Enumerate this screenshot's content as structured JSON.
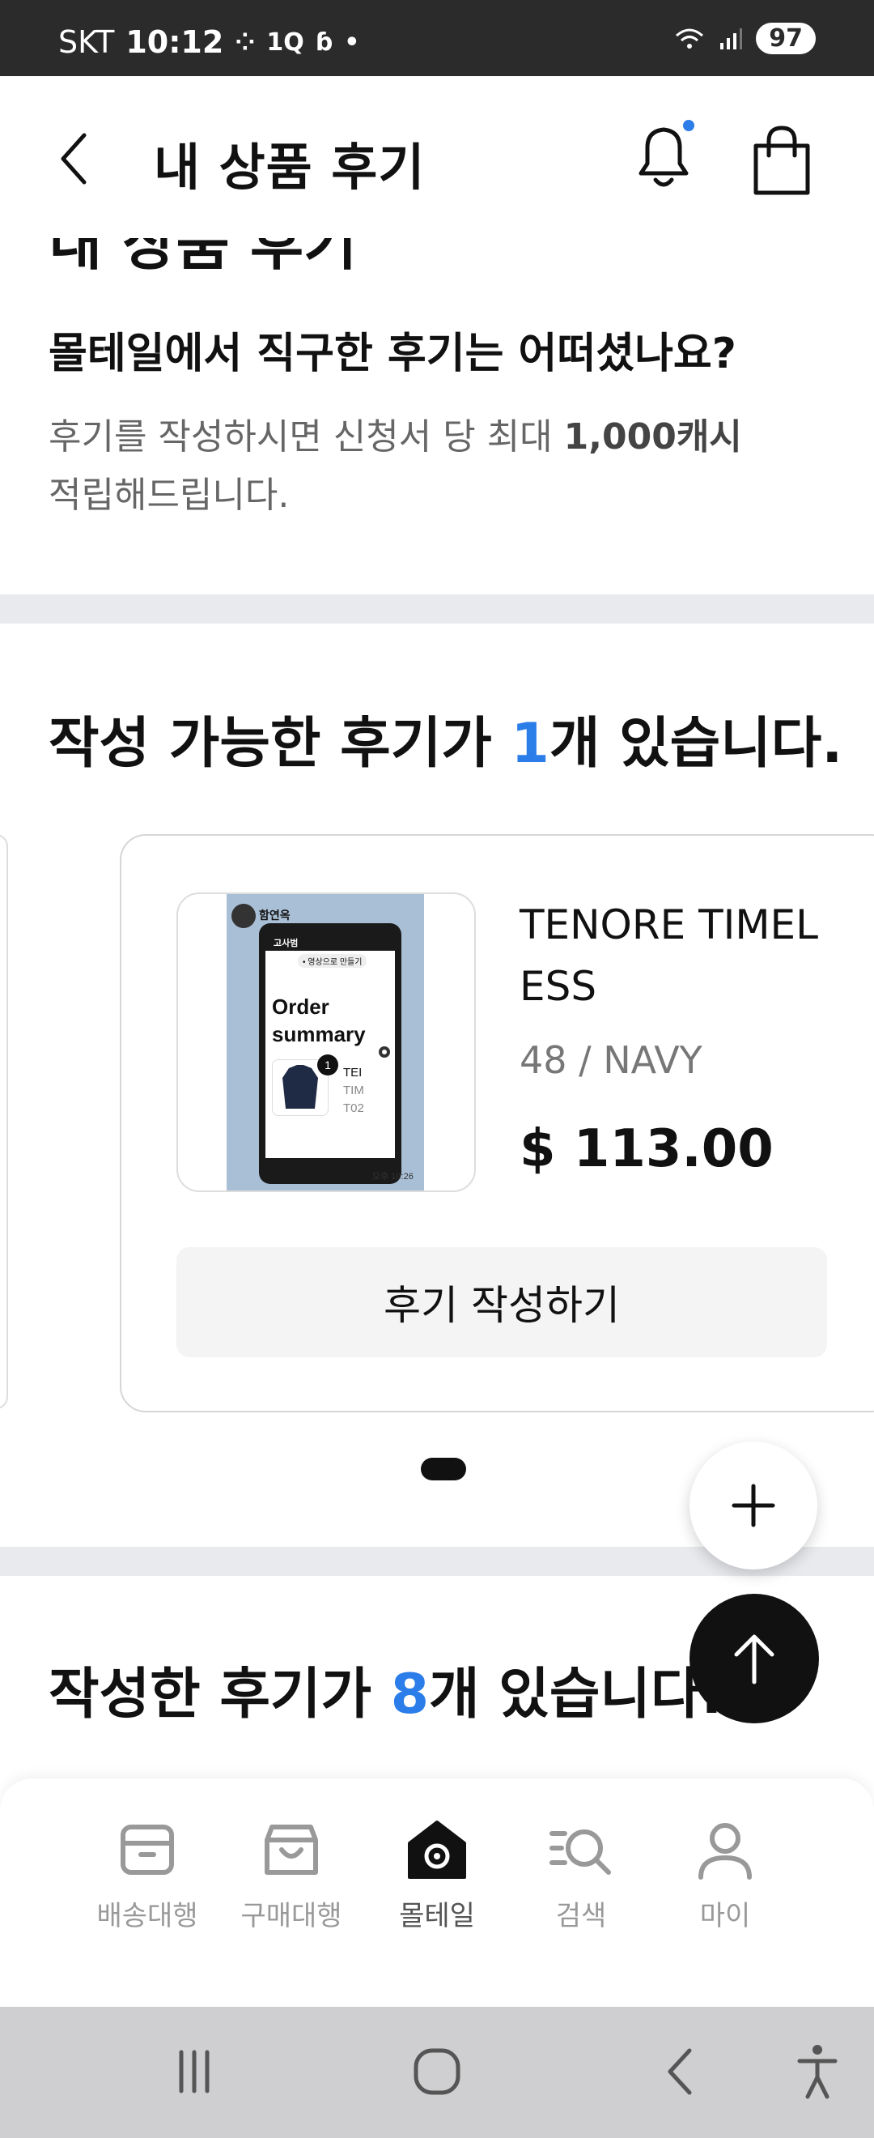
{
  "status_bar": {
    "carrier": "SKT",
    "time": "10:12",
    "battery": "97"
  },
  "header": {
    "title": "내 상품 후기",
    "back_icon": "chevron-left-icon",
    "bell_icon": "bell-icon",
    "cart_icon": "shopping-bag-icon",
    "notification_dot_color": "#2b7de9"
  },
  "intro": {
    "heading": "내 상품 후기",
    "subtitle": "몰테일에서 직구한 후기는 어떠셨나요?",
    "desc_prefix": "후기를 작성하시면 신청서 당 최대 ",
    "desc_bold": "1,000캐시",
    "desc_suffix": "적립해드립니다."
  },
  "writable_section": {
    "title_prefix": "작성 가능한 후기가 ",
    "count": "1",
    "title_suffix": "개 있습니다."
  },
  "review_card": {
    "product_name": "TENORE TIMELESS",
    "product_name_line1": "TENORE TIMEL",
    "product_name_line2": "ESS",
    "option": "48 / NAVY",
    "price": "$ 113.00",
    "write_button": "후기 작성하기",
    "thumbnail": {
      "sender": "함연옥",
      "chat_name": "고사범",
      "overlay_button": "• 영상으로 만들기",
      "order_line1": "Order",
      "order_line2": "summary",
      "badge": "1",
      "item_line1": "TEI",
      "item_line2": "TIM",
      "item_line3": "T02",
      "time": "오후 10:26"
    }
  },
  "written_section": {
    "title_prefix": "작성한 후기가 ",
    "count": "8",
    "title_suffix": "개 있습니다."
  },
  "fab": {
    "plus_icon": "plus-icon",
    "scroll_top_icon": "arrow-up-icon"
  },
  "bottom_nav": {
    "items": [
      {
        "label": "배송대행",
        "icon": "package-icon"
      },
      {
        "label": "구매대행",
        "icon": "shopping-box-icon"
      },
      {
        "label": "몰테일",
        "icon": "home-swirl-icon"
      },
      {
        "label": "검색",
        "icon": "search-list-icon"
      },
      {
        "label": "마이",
        "icon": "person-icon"
      }
    ]
  },
  "colors": {
    "accent": "#2b7de9",
    "divider": "#e9eaee",
    "nav_inactive": "#999999"
  }
}
